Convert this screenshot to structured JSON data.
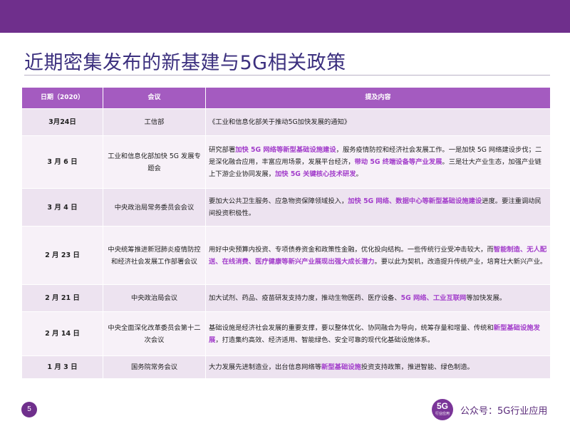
{
  "header": {
    "title": "近期密集发布的新基建与5G相关政策"
  },
  "table": {
    "columns": [
      "日期（2020）",
      "会议",
      "提及内容"
    ],
    "rows": [
      {
        "date": "3月24日",
        "meeting": "工信部",
        "content": [
          {
            "t": "《工业和信息化部关于推动5G加快发展的通知》",
            "hl": false
          }
        ]
      },
      {
        "date": "3 月 6 日",
        "meeting": "工业和信息化部加快 5G 发展专题会",
        "content": [
          {
            "t": "研究部署",
            "hl": false
          },
          {
            "t": "加快 5G 网络等新型基础设施建设",
            "hl": true
          },
          {
            "t": "，服务疫情防控和经济社会发展工作。一是加快 5G 网络建设步伐；二是深化融合应用，丰富应用场景，发展平台经济，",
            "hl": false
          },
          {
            "t": "带动 5G 终端设备等产业发展",
            "hl": true
          },
          {
            "t": "。三是壮大产业生态，加强产业链上下游企业协同发展，",
            "hl": false
          },
          {
            "t": "加快 5G 关键核心技术研发",
            "hl": true
          },
          {
            "t": "。",
            "hl": false
          }
        ]
      },
      {
        "date": "3 月 4 日",
        "meeting": "中央政治局常务委员会会议",
        "content": [
          {
            "t": "要加大公共卫生服务、应急物资保障领域投入，",
            "hl": false
          },
          {
            "t": "加快 5G 网络、数据中心等新型基础设施建设",
            "hl": true
          },
          {
            "t": "进度。要注重调动民间投资积极性。",
            "hl": false
          }
        ]
      },
      {
        "date": "2 月 23 日",
        "meeting": "中央统筹推进新冠肺炎疫情防控和经济社会发展工作部署会议",
        "content": [
          {
            "t": "用好中央预算内投资、专项债券资金和政策性金融，优化投向结构。一些传统行业受冲击较大，而",
            "hl": false
          },
          {
            "t": "智能制造、无人配送、在线消费、医疗健康等新兴产业展现出强大成长潜力",
            "hl": true
          },
          {
            "t": "。要以此为契机，改造提升传统产业，培育壮大新兴产业。",
            "hl": false
          }
        ]
      },
      {
        "date": "2 月 21 日",
        "meeting": "中央政治局会议",
        "content": [
          {
            "t": "加大试剂、药品、疫苗研发支持力度，推动生物医药、医疗设备、",
            "hl": false
          },
          {
            "t": "5G 网络、工业互联网",
            "hl": true
          },
          {
            "t": "等加快发展。",
            "hl": false
          }
        ]
      },
      {
        "date": "2 月 14 日",
        "meeting": "中央全面深化改革委员会第十二次会议",
        "content": [
          {
            "t": "基础设施是经济社会发展的重要支撑，要以整体优化、协同融合为导向，统筹存量和增量、传统和",
            "hl": false
          },
          {
            "t": "新型基础设施发展",
            "hl": true
          },
          {
            "t": "，打造集约高效、经济适用、智能绿色、安全可靠的现代化基础设施体系。",
            "hl": false
          }
        ]
      },
      {
        "date": "1 月 3 日",
        "meeting": "国务院常务会议",
        "content": [
          {
            "t": "大力发展先进制造业，出台信息网络等",
            "hl": false
          },
          {
            "t": "新型基础设施",
            "hl": true
          },
          {
            "t": "投资支持政策，推进智能、绿色制造。",
            "hl": false
          }
        ]
      }
    ]
  },
  "footer": {
    "page_number": "5",
    "badge_top": "5G",
    "badge_bottom": "行业应用",
    "account": "公众号：5G行业应用"
  },
  "colors": {
    "brand": "#6f2f8c",
    "header_row": "#a45bc0",
    "highlight": "#a33fcb",
    "title": "#3b2f7e"
  }
}
